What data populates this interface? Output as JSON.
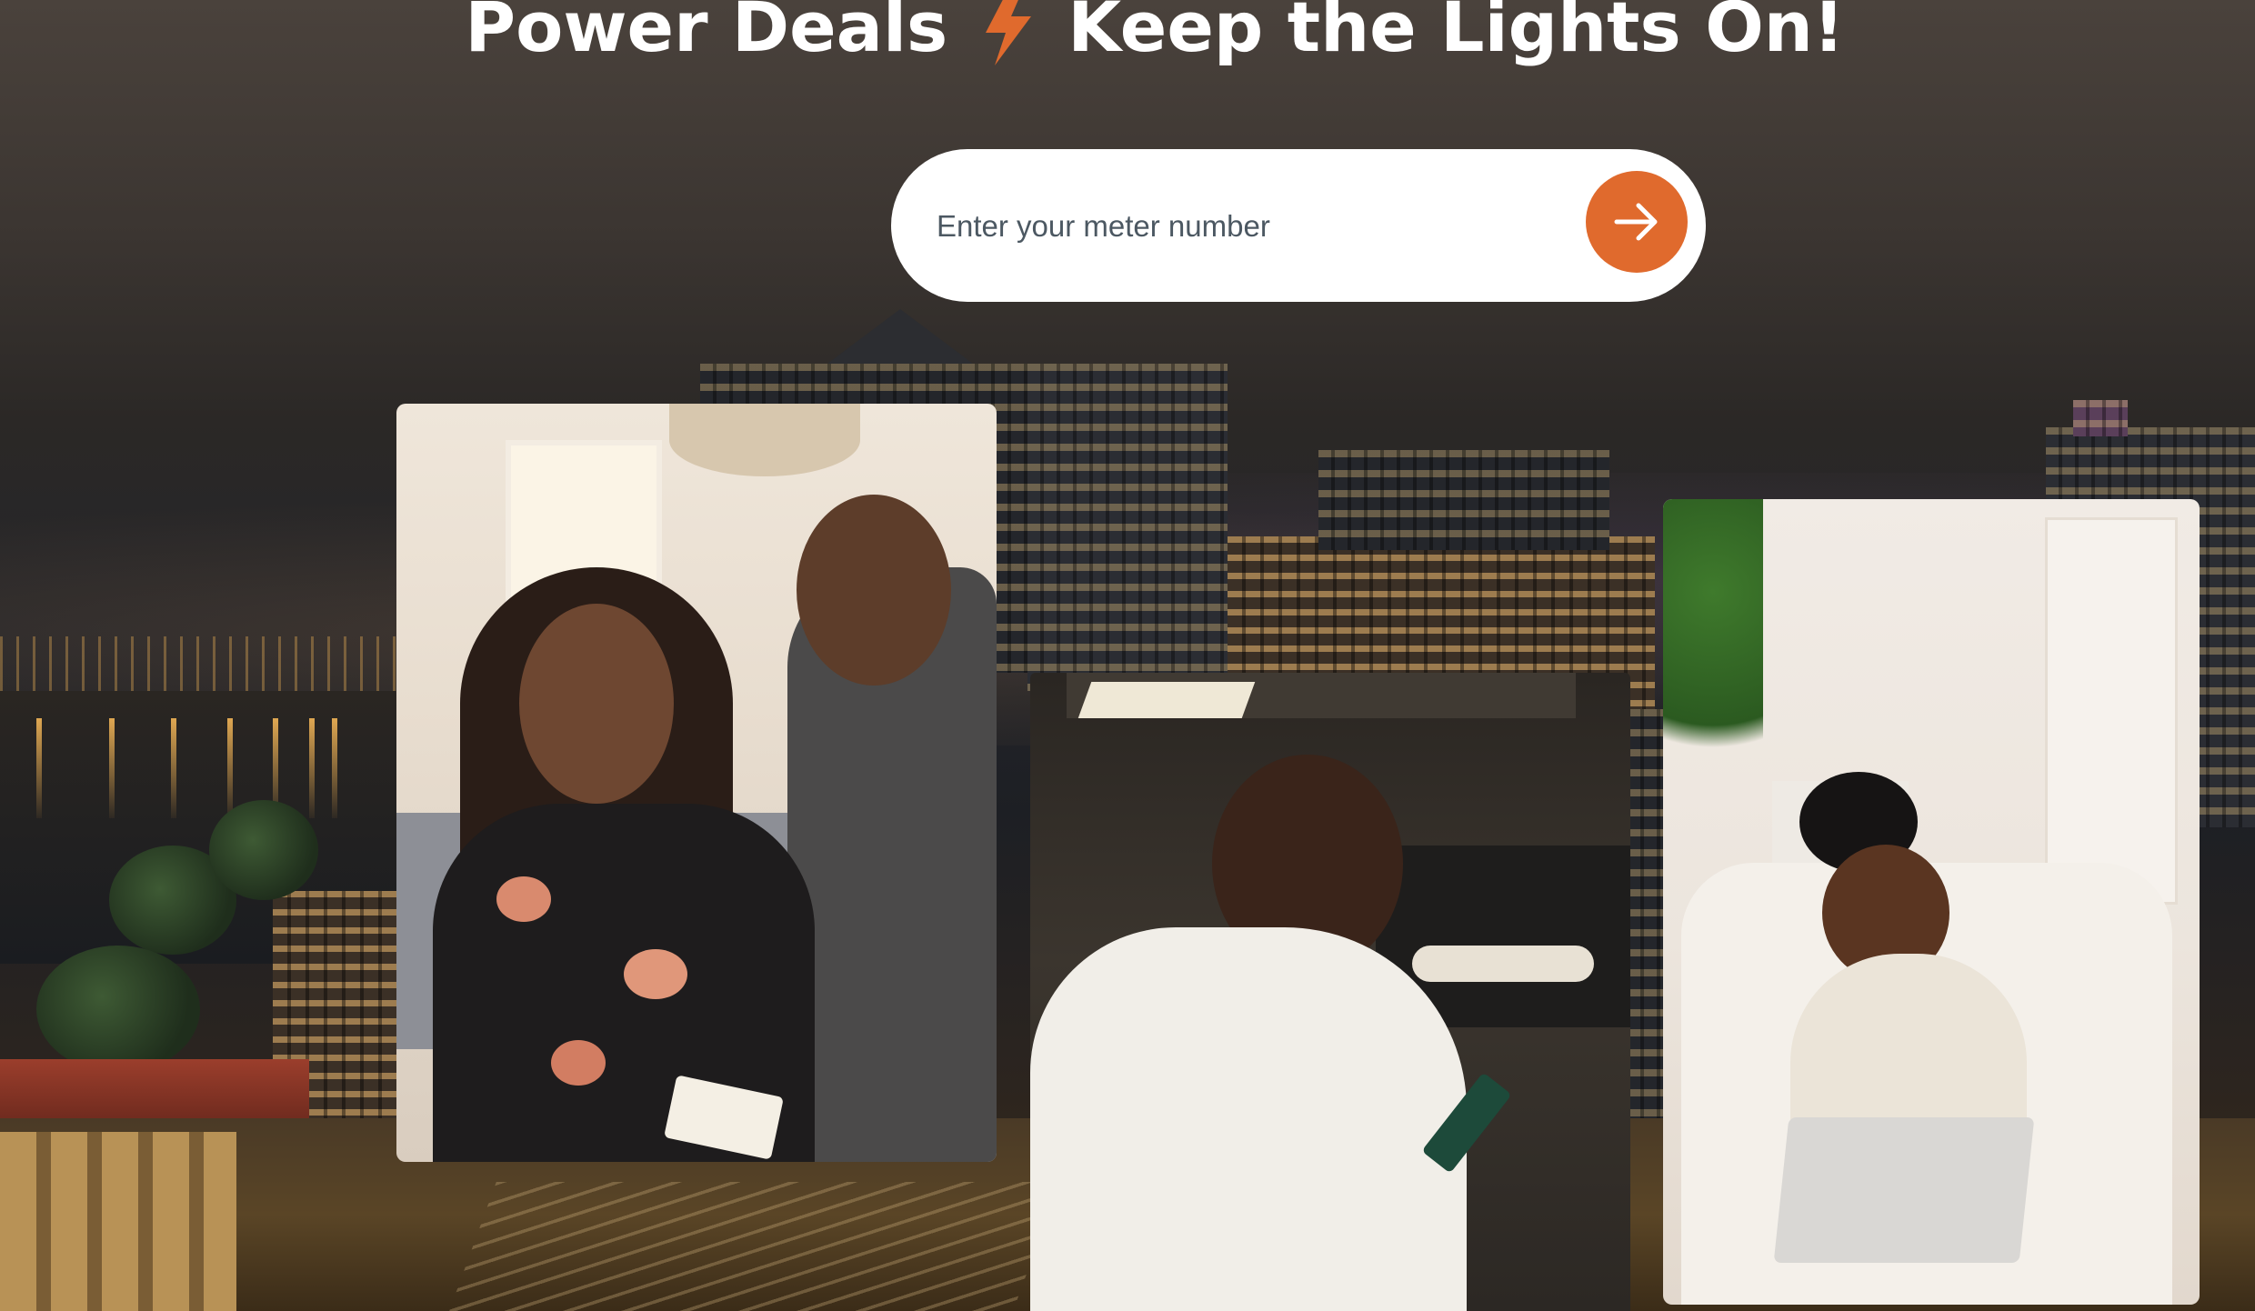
{
  "hero": {
    "headline_left": "Power Deals",
    "headline_right": "Keep the Lights On!",
    "accent_color": "#e06a2d",
    "headline_icon": "lightning-bolt-icon"
  },
  "meter_form": {
    "placeholder": "Enter your meter number",
    "value": "",
    "submit_icon": "arrow-right-icon"
  },
  "photos": [
    {
      "name": "couple-at-laptop-photo"
    },
    {
      "name": "woman-using-phone-photo"
    },
    {
      "name": "woman-with-laptop-on-sofa-photo"
    }
  ]
}
